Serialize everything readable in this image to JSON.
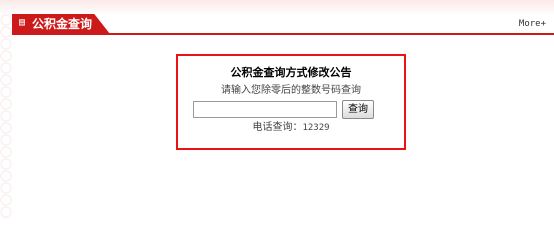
{
  "header": {
    "tab_icon": "document-icon",
    "title": "公积金查询",
    "more_label": "More+",
    "accent_color": "#cc1a1a"
  },
  "notice": {
    "title": "公积金查询方式修改公告",
    "hint": "请输入您除零后的整数号码查询",
    "input_value": "",
    "input_placeholder": "",
    "query_button_label": "查询",
    "phone_label": "电话查询：",
    "phone_number": "12329",
    "border_color": "#ee1111"
  }
}
